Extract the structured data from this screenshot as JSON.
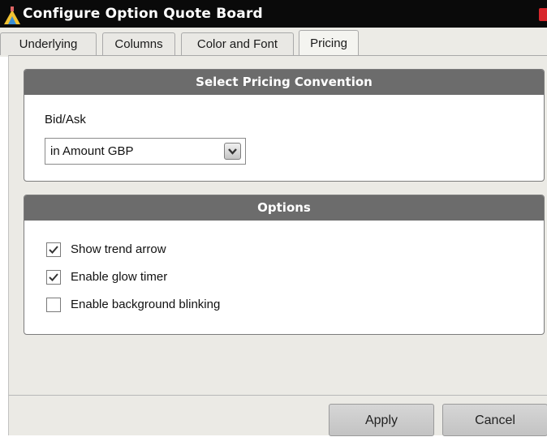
{
  "window": {
    "title": "Configure Option Quote Board"
  },
  "tabs": [
    {
      "label": "Underlying",
      "active": false
    },
    {
      "label": "Columns",
      "active": false
    },
    {
      "label": "Color and Font",
      "active": false
    },
    {
      "label": "Pricing",
      "active": true
    }
  ],
  "pricing_section": {
    "header": "Select Pricing Convention",
    "field_label": "Bid/Ask",
    "selected_value": "in Amount GBP"
  },
  "options_section": {
    "header": "Options",
    "items": [
      {
        "label": "Show trend arrow",
        "checked": true
      },
      {
        "label": "Enable glow timer",
        "checked": true
      },
      {
        "label": "Enable background blinking",
        "checked": false
      }
    ]
  },
  "footer": {
    "apply_label": "Apply",
    "cancel_label": "Cancel"
  },
  "icons": {
    "app": "app-icon",
    "close": "close-icon",
    "dropdown": "chevron-down-icon",
    "check": "checkmark-icon"
  },
  "colors": {
    "titlebar": "#0a0a0a",
    "group_header": "#6c6c6c",
    "panel_background": "#ebeae5",
    "close_button": "#d8272c"
  }
}
